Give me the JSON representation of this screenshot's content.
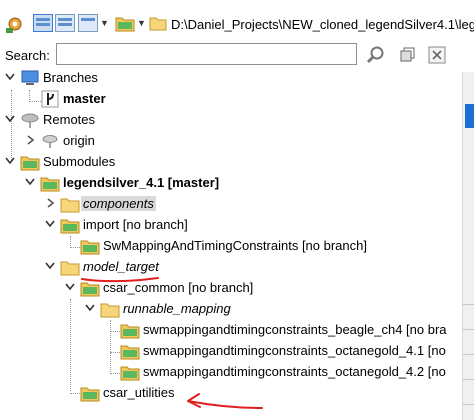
{
  "toolbar": {
    "path": "D:\\Daniel_Projects\\NEW_cloned_legendSilver4.1\\leg",
    "icons": [
      "gear-icon",
      "view-tree-icon",
      "view-split-icon",
      "view-list-icon",
      "repository-folder-icon",
      "folder-icon"
    ]
  },
  "search": {
    "label": "Search:",
    "value": ""
  },
  "tree": {
    "branches_label": "Branches",
    "master_label": "master",
    "remotes_label": "Remotes",
    "origin_label": "origin",
    "submodules_label": "Submodules",
    "legendsilver_label": "legendsilver_4.1 [master]",
    "components_label": "components",
    "import_label": "import [no branch]",
    "swmapping_label": "SwMappingAndTimingConstraints [no branch]",
    "model_target_label": "model_target",
    "csar_common_label": "csar_common [no branch]",
    "runnable_mapping_label": "runnable_mapping",
    "beagle_label": "swmappingandtimingconstraints_beagle_ch4 [no bra",
    "octane41_label": "swmappingandtimingconstraints_octanegold_4.1 [no",
    "octane42_label": "swmappingandtimingconstraints_octanegold_4.2 [no",
    "csar_utilities_label": "csar_utilities"
  },
  "colors": {
    "annotation_red": "#e02020",
    "folder_yellow": "#f2c75c",
    "submodule_green": "#4caf50",
    "selection_gray": "#d9d9d9"
  }
}
